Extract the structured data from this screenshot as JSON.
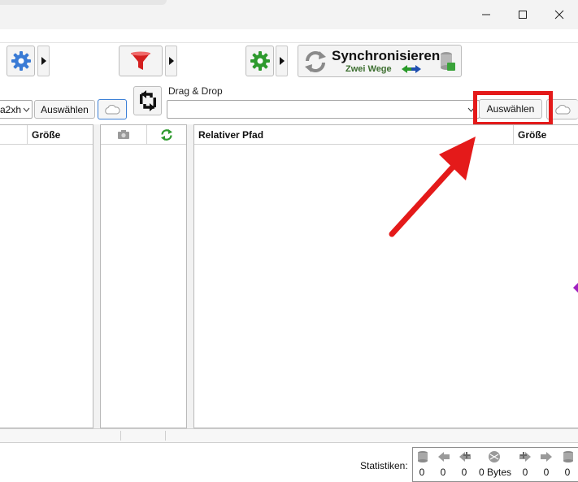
{
  "toolbar": {
    "sync_title": "Synchronisieren",
    "sync_subtitle": "Zwei Wege"
  },
  "left_folder": {
    "value": "a2xh",
    "select_button": "Auswählen"
  },
  "right_folder": {
    "drag_drop_label": "Drag & Drop",
    "value": "",
    "select_button": "Auswählen"
  },
  "left_grid": {
    "columns": [
      "",
      "Größe"
    ]
  },
  "right_grid": {
    "columns": [
      "Relativer Pfad",
      "Größe"
    ]
  },
  "statistics": {
    "label": "Statistiken:",
    "values": [
      "0",
      "0",
      "0",
      "0 Bytes",
      "0",
      "0",
      "0"
    ]
  },
  "colors": {
    "annotation": "#e41a1a",
    "gear_blue": "#3a7bd5",
    "gear_green": "#2e9a2e",
    "filter_red": "#d42020"
  }
}
